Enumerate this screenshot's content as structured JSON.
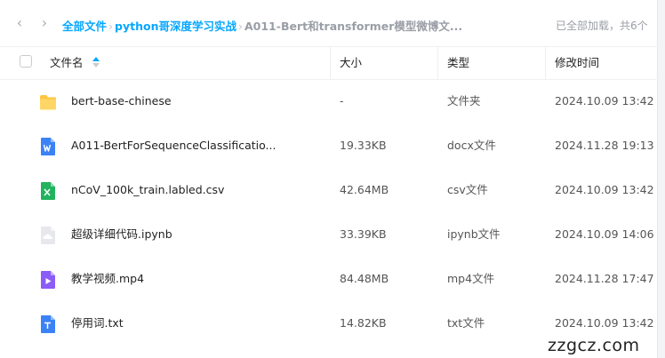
{
  "breadcrumb": {
    "root": "全部文件",
    "sep": "›",
    "folder1": "python哥深度学习实战",
    "current": "A011-Bert和transformer模型微博文..."
  },
  "status": "已全部加载，共6个",
  "columns": {
    "name": "文件名",
    "size": "大小",
    "type": "类型",
    "modified": "修改时间"
  },
  "rows": [
    {
      "name": "bert-base-chinese",
      "size": "-",
      "type": "文件夹",
      "modified": "2024.10.09 13:42",
      "icon": "folder-icon"
    },
    {
      "name": "A011-BertForSequenceClassificatio...",
      "size": "19.33KB",
      "type": "docx文件",
      "modified": "2024.11.28 19:13",
      "icon": "word-doc-icon"
    },
    {
      "name": "nCoV_100k_train.labled.csv",
      "size": "42.64MB",
      "type": "csv文件",
      "modified": "2024.10.09 13:42",
      "icon": "excel-csv-icon"
    },
    {
      "name": "超级详细代码.ipynb",
      "size": "33.39KB",
      "type": "ipynb文件",
      "modified": "2024.10.09 14:06",
      "icon": "cloud-file-icon"
    },
    {
      "name": "教学视频.mp4",
      "size": "84.48MB",
      "type": "mp4文件",
      "modified": "2024.11.28 17:47",
      "icon": "video-file-icon"
    },
    {
      "name": "停用词.txt",
      "size": "14.82KB",
      "type": "txt文件",
      "modified": "2024.10.09 13:42",
      "icon": "text-file-icon"
    }
  ],
  "watermark": "zzgcz.com",
  "colors": {
    "accent": "#06a7ff",
    "folder": "#ffc53d",
    "word": "#3b82f6",
    "excel": "#22b35e",
    "video": "#8b5cf6",
    "text": "#3b82f6",
    "cloud": "#d9dce1"
  }
}
